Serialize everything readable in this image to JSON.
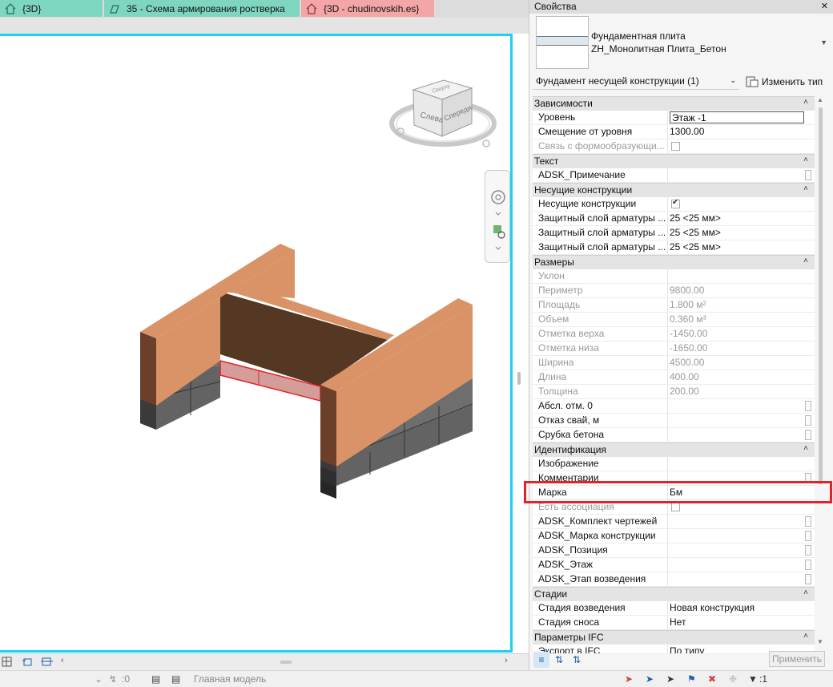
{
  "tabs": [
    {
      "label": "{3D}"
    },
    {
      "label": "35 - Схема армирования ростверка"
    },
    {
      "label": "{3D - chudinovskih.es}"
    }
  ],
  "viewcube": {
    "face_left": "Слева",
    "face_front": "Спереди",
    "face_top": "Сверху"
  },
  "properties": {
    "title": "Свойства",
    "type_family": "Фундаментная плита",
    "type_name": "ZH_Монолитная Плита_Бетон",
    "filter": "Фундамент несущей конструкции (1)",
    "edit_type": "Изменить тип",
    "sections": [
      {
        "name": "Зависимости",
        "rows": [
          {
            "label": "Уровень",
            "value": "Этаж -1",
            "boxed": true
          },
          {
            "label": "Смещение от уровня",
            "value": "1300.00"
          },
          {
            "label": "Связь с формообразующи...",
            "value": "",
            "checkbox": "off",
            "disabled": true
          }
        ]
      },
      {
        "name": "Текст",
        "rows": [
          {
            "label": "ADSK_Примечание",
            "value": "",
            "mini": true
          }
        ]
      },
      {
        "name": "Несущие конструкции",
        "rows": [
          {
            "label": "Несущие конструкции",
            "value": "",
            "checkbox": "on"
          },
          {
            "label": "Защитный слой арматуры ...",
            "value": "25 <25 мм>"
          },
          {
            "label": "Защитный слой арматуры ...",
            "value": "25 <25 мм>"
          },
          {
            "label": "Защитный слой арматуры ...",
            "value": "25 <25 мм>"
          }
        ]
      },
      {
        "name": "Размеры",
        "rows": [
          {
            "label": "Уклон",
            "value": "",
            "disabled": true
          },
          {
            "label": "Периметр",
            "value": "9800.00",
            "disabled": true
          },
          {
            "label": "Площадь",
            "value": "1.800 м²",
            "disabled": true
          },
          {
            "label": "Объем",
            "value": "0.360 м³",
            "disabled": true
          },
          {
            "label": "Отметка верха",
            "value": "-1450.00",
            "disabled": true
          },
          {
            "label": "Отметка низа",
            "value": "-1650.00",
            "disabled": true
          },
          {
            "label": "Ширина",
            "value": "4500.00",
            "disabled": true
          },
          {
            "label": "Длина",
            "value": "400.00",
            "disabled": true
          },
          {
            "label": "Толщина",
            "value": "200.00",
            "disabled": true
          },
          {
            "label": "Абсл. отм. 0",
            "value": "",
            "mini": true
          },
          {
            "label": "Отказ свай, м",
            "value": "",
            "mini": true
          },
          {
            "label": "Срубка бетона",
            "value": "",
            "mini": true
          }
        ]
      },
      {
        "name": "Идентификация",
        "rows": [
          {
            "label": "Изображение",
            "value": ""
          },
          {
            "label": "Комментарии",
            "value": "",
            "mini": true
          },
          {
            "label": "Марка",
            "value": "Бм"
          },
          {
            "label": "Есть ассоциация",
            "value": "",
            "checkbox": "off",
            "disabled": true
          },
          {
            "label": "ADSK_Комплект чертежей",
            "value": "",
            "mini": true
          },
          {
            "label": "ADSK_Марка конструкции",
            "value": "",
            "mini": true
          },
          {
            "label": "ADSK_Позиция",
            "value": "",
            "mini": true
          },
          {
            "label": "ADSK_Этаж",
            "value": "",
            "mini": true
          },
          {
            "label": "ADSK_Этап возведения",
            "value": "",
            "mini": true
          }
        ]
      },
      {
        "name": "Стадии",
        "rows": [
          {
            "label": "Стадия возведения",
            "value": "Новая конструкция"
          },
          {
            "label": "Стадия сноса",
            "value": "Нет"
          }
        ]
      },
      {
        "name": "Параметры IFC",
        "rows": [
          {
            "label": "Экспорт в IFC",
            "value": "По типу",
            "partial": true
          }
        ]
      }
    ],
    "apply": "Применить"
  },
  "bottombar": {
    "scale_icon": "grid-icon"
  },
  "statusbar": {
    "coord": ":0",
    "model": "Главная модель",
    "filter_count": ":1"
  },
  "colors": {
    "accent": "#1bd0f5",
    "highlight": "#e0242a",
    "wall_face": "#d99366",
    "wall_side": "#6b3f2a",
    "inner": "#553823",
    "pile": "#6d6d6d",
    "slab_sel": "#d4322e"
  }
}
